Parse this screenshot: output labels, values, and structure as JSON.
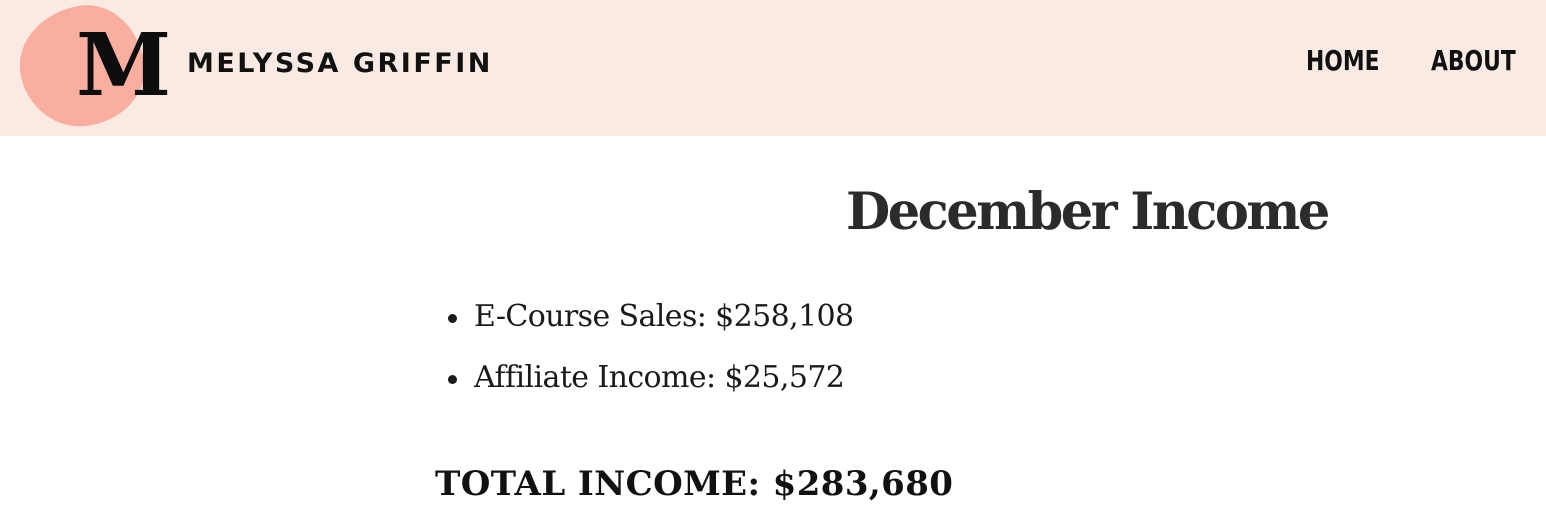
{
  "header": {
    "logo_letter": "M",
    "logo_name": "MELYSSA GRIFFIN",
    "nav": [
      {
        "label": "HOME"
      },
      {
        "label": "ABOUT"
      }
    ],
    "colors": {
      "background": "#f9ebe4",
      "logo_blob": "#f9aea0"
    }
  },
  "main": {
    "heading": "December Income",
    "items": [
      {
        "label": "E-Course Sales: $258,108"
      },
      {
        "label": "Affiliate Income: $25,572"
      }
    ],
    "total": "TOTAL INCOME: $283,680"
  }
}
